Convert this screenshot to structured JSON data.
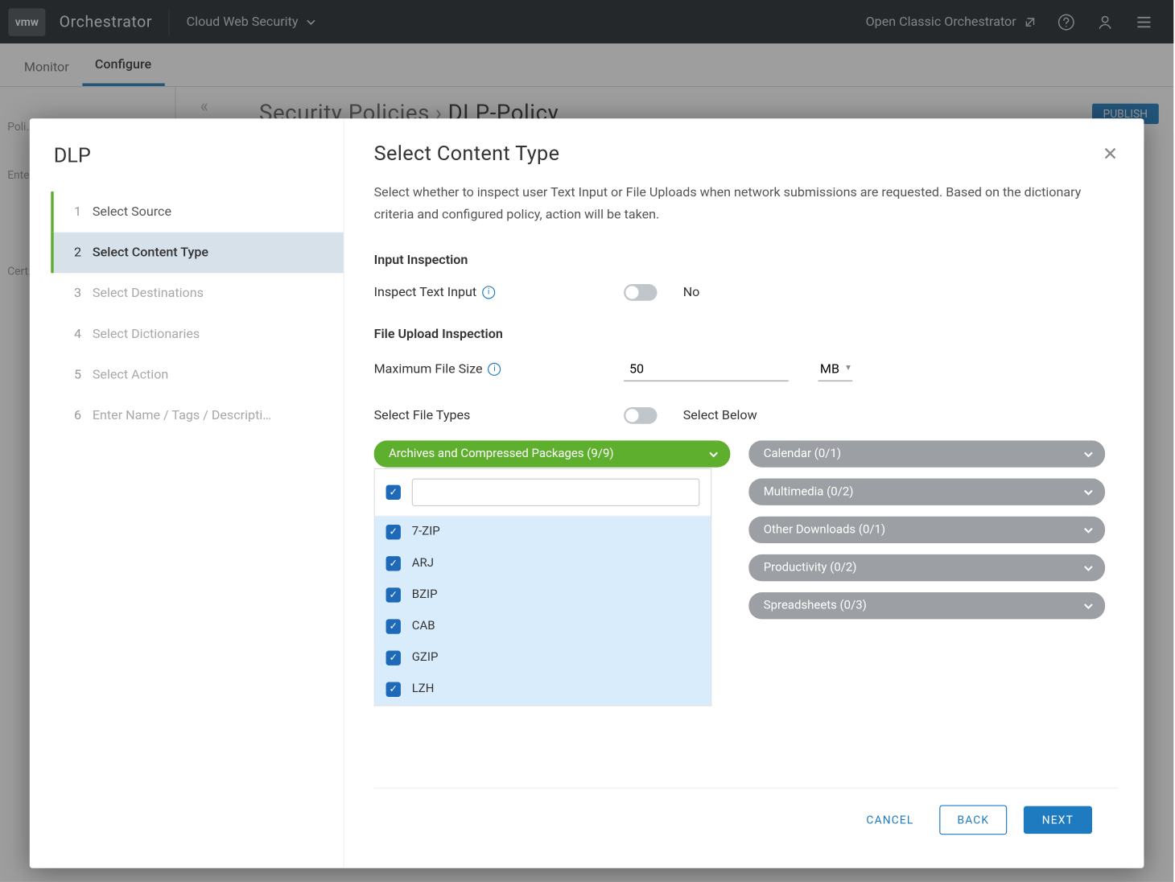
{
  "topbar": {
    "logo": "vmw",
    "brand": "Orchestrator",
    "service": "Cloud Web Security",
    "classic": "Open Classic Orchestrator"
  },
  "subnav": {
    "tabs": [
      "Monitor",
      "Configure"
    ],
    "active": 1
  },
  "breadcrumb": {
    "a": "Security Policies",
    "b": "DLP-Policy"
  },
  "publish": "PUBLISH",
  "bg_left": {
    "h1": "Poli…",
    "h2": "Ente…",
    "h3": "Cert…"
  },
  "modal": {
    "title": "DLP",
    "steps": [
      {
        "n": "1",
        "label": "Select Source"
      },
      {
        "n": "2",
        "label": "Select Content Type"
      },
      {
        "n": "3",
        "label": "Select Destinations"
      },
      {
        "n": "4",
        "label": "Select Dictionaries"
      },
      {
        "n": "5",
        "label": "Select Action"
      },
      {
        "n": "6",
        "label": "Enter Name / Tags / Descripti…"
      }
    ],
    "heading": "Select Content Type",
    "desc": "Select whether to inspect user Text Input or File Uploads when network submissions are requested. Based on the dictionary criteria and configured policy, action will be taken.",
    "input_inspection": {
      "title": "Input Inspection",
      "label": "Inspect Text Input",
      "value": "No"
    },
    "file_upload": {
      "title": "File Upload Inspection",
      "max_label": "Maximum File Size",
      "max_value": "50",
      "unit": "MB",
      "select_ft_label": "Select File Types",
      "select_ft_value": "Select Below"
    },
    "left_pill": "Archives and Compressed Packages (9/9)",
    "dd_items": [
      "7-ZIP",
      "ARJ",
      "BZIP",
      "CAB",
      "GZIP",
      "LZH"
    ],
    "right_pills": [
      "Calendar (0/1)",
      "Multimedia (0/2)",
      "Other Downloads (0/1)",
      "Productivity (0/2)",
      "Spreadsheets (0/3)"
    ],
    "footer": {
      "cancel": "CANCEL",
      "back": "BACK",
      "next": "NEXT"
    }
  }
}
